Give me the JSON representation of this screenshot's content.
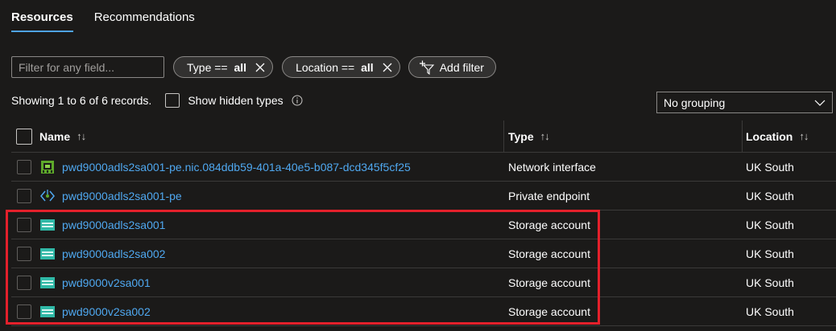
{
  "tabs": [
    {
      "label": "Resources",
      "active": true
    },
    {
      "label": "Recommendations",
      "active": false
    }
  ],
  "filter": {
    "placeholder": "Filter for any field...",
    "pills": [
      {
        "key": "Type == ",
        "value": "all"
      },
      {
        "key": "Location == ",
        "value": "all"
      }
    ],
    "add_label": "Add filter"
  },
  "records_text": "Showing 1 to 6 of 6 records.",
  "show_hidden_label": "Show hidden types",
  "grouping_value": "No grouping",
  "columns": {
    "name": "Name",
    "type": "Type",
    "location": "Location",
    "sort_glyph": "↑↓"
  },
  "rows": [
    {
      "name": "pwd9000adls2sa001-pe.nic.084ddb59-401a-40e5-b087-dcd345f5cf25",
      "type": "Network interface",
      "location": "UK South",
      "icon": "network-interface-icon"
    },
    {
      "name": "pwd9000adls2sa001-pe",
      "type": "Private endpoint",
      "location": "UK South",
      "icon": "private-endpoint-icon"
    },
    {
      "name": "pwd9000adls2sa001",
      "type": "Storage account",
      "location": "UK South",
      "icon": "storage-account-icon"
    },
    {
      "name": "pwd9000adls2sa002",
      "type": "Storage account",
      "location": "UK South",
      "icon": "storage-account-icon"
    },
    {
      "name": "pwd9000v2sa001",
      "type": "Storage account",
      "location": "UK South",
      "icon": "storage-account-icon"
    },
    {
      "name": "pwd9000v2sa002",
      "type": "Storage account",
      "location": "UK South",
      "icon": "storage-account-icon"
    }
  ],
  "colors": {
    "link": "#4fa8f0",
    "highlight": "#e4202b",
    "tab_underline": "#4fa3e6",
    "background": "#1b1a19"
  }
}
